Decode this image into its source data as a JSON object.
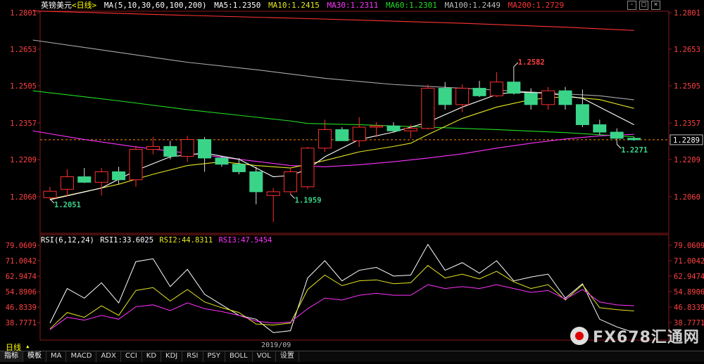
{
  "header": {
    "symbol": "英镑美元",
    "period_tag": "<日线>",
    "ma_params": "MA(5,10,30,60,100,200)",
    "ma5": "MA5:1.2350",
    "ma10": "MA10:1.2415",
    "ma30": "MA30:1.2311",
    "ma60": "MA60:1.2301",
    "ma100": "MA100:1.2449",
    "ma200": "MA200:1.2729"
  },
  "rsi_header": {
    "params": "RSI(6,12,24)",
    "rsi1": "RSI1:33.6025",
    "rsi2": "RSI2:44.8311",
    "rsi3": "RSI3:47.5454"
  },
  "window_controls": [
    "-",
    "□",
    "×"
  ],
  "period_button": "日线",
  "bottom_tabs": [
    "指标",
    "模板",
    "MA",
    "MACD",
    "ADX",
    "CCI",
    "KD",
    "KDJ",
    "RSI",
    "PSY",
    "BOLL",
    "VOL",
    "设置"
  ],
  "watermark": "FX678汇通网",
  "colors": {
    "up": "#ff3030",
    "down": "#3ad489",
    "ma5": "#ffffff",
    "ma10": "#e6e622",
    "ma30": "#ff33ff",
    "ma60": "#22dd22",
    "ma100": "#aaaaaa",
    "ma200": "#ff3333",
    "rsi1": "#ffffff",
    "rsi2": "#e6e622",
    "rsi3": "#ff33ff",
    "axis_text": "#ff4040",
    "dashed": "#ff8800"
  },
  "chart_data": [
    {
      "type": "candlestick",
      "ylim": [
        1.1933,
        1.282
      ],
      "y_ticks": [
        "1.2801",
        "1.2653",
        "1.2505",
        "1.2357",
        "1.2209",
        "1.2060"
      ],
      "x_label": "2019/09",
      "current_price": "1.2289",
      "annotations": [
        {
          "text": "1.2051",
          "candle": 0
        },
        {
          "text": "1.1959",
          "candle": 14
        },
        {
          "text": "1.2582",
          "candle": 27
        },
        {
          "text": "1.2271",
          "candle": 33
        }
      ],
      "candles": [
        {
          "o": 1.2056,
          "h": 1.21,
          "l": 1.2051,
          "c": 1.2082
        },
        {
          "o": 1.209,
          "h": 1.217,
          "l": 1.206,
          "c": 1.214
        },
        {
          "o": 1.214,
          "h": 1.2175,
          "l": 1.2115,
          "c": 1.2118
        },
        {
          "o": 1.2118,
          "h": 1.2175,
          "l": 1.2065,
          "c": 1.216
        },
        {
          "o": 1.216,
          "h": 1.218,
          "l": 1.211,
          "c": 1.2128
        },
        {
          "o": 1.2128,
          "h": 1.2265,
          "l": 1.21,
          "c": 1.225
        },
        {
          "o": 1.225,
          "h": 1.23,
          "l": 1.223,
          "c": 1.2262
        },
        {
          "o": 1.2262,
          "h": 1.2285,
          "l": 1.221,
          "c": 1.2222
        },
        {
          "o": 1.2222,
          "h": 1.2305,
          "l": 1.22,
          "c": 1.229
        },
        {
          "o": 1.229,
          "h": 1.23,
          "l": 1.216,
          "c": 1.2215
        },
        {
          "o": 1.2215,
          "h": 1.2222,
          "l": 1.218,
          "c": 1.219
        },
        {
          "o": 1.219,
          "h": 1.2215,
          "l": 1.215,
          "c": 1.216
        },
        {
          "o": 1.216,
          "h": 1.218,
          "l": 1.203,
          "c": 1.208
        },
        {
          "o": 1.2065,
          "h": 1.2095,
          "l": 1.1959,
          "c": 1.208
        },
        {
          "o": 1.208,
          "h": 1.2175,
          "l": 1.207,
          "c": 1.216
        },
        {
          "o": 1.21,
          "h": 1.226,
          "l": 1.209,
          "c": 1.2255
        },
        {
          "o": 1.2255,
          "h": 1.237,
          "l": 1.224,
          "c": 1.233
        },
        {
          "o": 1.233,
          "h": 1.234,
          "l": 1.2285,
          "c": 1.2285
        },
        {
          "o": 1.2285,
          "h": 1.238,
          "l": 1.226,
          "c": 1.234
        },
        {
          "o": 1.234,
          "h": 1.236,
          "l": 1.23,
          "c": 1.2345
        },
        {
          "o": 1.2345,
          "h": 1.236,
          "l": 1.232,
          "c": 1.2325
        },
        {
          "o": 1.2325,
          "h": 1.235,
          "l": 1.2295,
          "c": 1.2335
        },
        {
          "o": 1.2335,
          "h": 1.251,
          "l": 1.233,
          "c": 1.2495
        },
        {
          "o": 1.2495,
          "h": 1.252,
          "l": 1.241,
          "c": 1.243
        },
        {
          "o": 1.243,
          "h": 1.251,
          "l": 1.24,
          "c": 1.2495
        },
        {
          "o": 1.2495,
          "h": 1.2525,
          "l": 1.246,
          "c": 1.2465
        },
        {
          "o": 1.2465,
          "h": 1.256,
          "l": 1.246,
          "c": 1.252
        },
        {
          "o": 1.252,
          "h": 1.2582,
          "l": 1.247,
          "c": 1.2475
        },
        {
          "o": 1.2475,
          "h": 1.2495,
          "l": 1.241,
          "c": 1.243
        },
        {
          "o": 1.243,
          "h": 1.25,
          "l": 1.241,
          "c": 1.2485
        },
        {
          "o": 1.2485,
          "h": 1.25,
          "l": 1.241,
          "c": 1.243
        },
        {
          "o": 1.243,
          "h": 1.249,
          "l": 1.234,
          "c": 1.235
        },
        {
          "o": 1.235,
          "h": 1.237,
          "l": 1.231,
          "c": 1.232
        },
        {
          "o": 1.232,
          "h": 1.2335,
          "l": 1.2271,
          "c": 1.2295
        },
        {
          "o": 1.2295,
          "h": 1.23,
          "l": 1.2285,
          "c": 1.2289
        }
      ],
      "ma_lines": {
        "ma5": [
          [
            0,
            1.2048
          ],
          [
            3,
            1.2095
          ],
          [
            5,
            1.2165
          ],
          [
            7,
            1.222
          ],
          [
            9,
            1.2235
          ],
          [
            11,
            1.221
          ],
          [
            13,
            1.214
          ],
          [
            14,
            1.2145
          ],
          [
            15,
            1.217
          ],
          [
            16,
            1.222
          ],
          [
            18,
            1.229
          ],
          [
            20,
            1.232
          ],
          [
            22,
            1.236
          ],
          [
            24,
            1.242
          ],
          [
            26,
            1.247
          ],
          [
            27,
            1.248
          ],
          [
            29,
            1.2475
          ],
          [
            31,
            1.2455
          ],
          [
            33,
            1.2385
          ],
          [
            34,
            1.235
          ]
        ],
        "ma10": [
          [
            0,
            1.205
          ],
          [
            4,
            1.211
          ],
          [
            6,
            1.215
          ],
          [
            8,
            1.2185
          ],
          [
            10,
            1.22
          ],
          [
            12,
            1.2185
          ],
          [
            14,
            1.2175
          ],
          [
            16,
            1.2205
          ],
          [
            18,
            1.224
          ],
          [
            20,
            1.2262
          ],
          [
            21,
            1.2275
          ],
          [
            22,
            1.231
          ],
          [
            24,
            1.2375
          ],
          [
            26,
            1.242
          ],
          [
            28,
            1.245
          ],
          [
            30,
            1.2462
          ],
          [
            32,
            1.245
          ],
          [
            34,
            1.2415
          ]
        ],
        "ma30": [
          [
            -1,
            1.2325
          ],
          [
            2,
            1.229
          ],
          [
            5,
            1.226
          ],
          [
            8,
            1.2235
          ],
          [
            11,
            1.221
          ],
          [
            14,
            1.2185
          ],
          [
            16,
            1.218
          ],
          [
            18,
            1.2188
          ],
          [
            20,
            1.22
          ],
          [
            22,
            1.2215
          ],
          [
            24,
            1.2232
          ],
          [
            26,
            1.2255
          ],
          [
            28,
            1.2275
          ],
          [
            30,
            1.2292
          ],
          [
            32,
            1.2305
          ],
          [
            34,
            1.2311
          ]
        ],
        "ma60": [
          [
            -1,
            1.2485
          ],
          [
            4,
            1.2445
          ],
          [
            8,
            1.241
          ],
          [
            12,
            1.238
          ],
          [
            14,
            1.2365
          ],
          [
            15,
            1.2355
          ],
          [
            18,
            1.235
          ],
          [
            22,
            1.234
          ],
          [
            26,
            1.233
          ],
          [
            30,
            1.2318
          ],
          [
            34,
            1.2301
          ]
        ],
        "ma100": [
          [
            -1,
            1.269
          ],
          [
            4,
            1.264
          ],
          [
            8,
            1.26
          ],
          [
            12,
            1.257
          ],
          [
            16,
            1.2535
          ],
          [
            20,
            1.251
          ],
          [
            24,
            1.2495
          ],
          [
            28,
            1.248
          ],
          [
            32,
            1.2465
          ],
          [
            34,
            1.2449
          ]
        ],
        "ma200": [
          [
            -1,
            1.2808
          ],
          [
            8,
            1.279
          ],
          [
            16,
            1.2775
          ],
          [
            24,
            1.2758
          ],
          [
            30,
            1.2742
          ],
          [
            34,
            1.2729
          ]
        ]
      }
    },
    {
      "type": "line",
      "name": "RSI",
      "ylim": [
        31.5,
        81.5
      ],
      "y_ticks": [
        "79.0609",
        "71.0042",
        "62.9474",
        "54.8906",
        "46.8339",
        "38.7771"
      ],
      "series": [
        {
          "name": "RSI1",
          "values": [
            38.5,
            56.5,
            51.5,
            59.5,
            49.0,
            70.5,
            72.0,
            57.5,
            66.5,
            53.5,
            48.0,
            42.5,
            40.5,
            33.5,
            34.5,
            62.0,
            71.0,
            60.5,
            66.0,
            67.5,
            63.0,
            63.5,
            79.5,
            66.0,
            70.0,
            64.5,
            71.0,
            60.5,
            62.5,
            64.0,
            51.5,
            59.0,
            40.5,
            36.5,
            33.6
          ]
        },
        {
          "name": "RSI2",
          "values": [
            35.5,
            44.0,
            41.5,
            47.5,
            42.5,
            55.5,
            57.0,
            50.0,
            56.0,
            49.5,
            46.5,
            44.0,
            38.0,
            37.5,
            38.5,
            56.0,
            63.5,
            58.0,
            60.5,
            61.0,
            59.0,
            59.5,
            68.5,
            62.0,
            64.0,
            61.5,
            65.5,
            60.0,
            56.5,
            58.5,
            50.5,
            58.5,
            46.5,
            45.5,
            44.8
          ]
        },
        {
          "name": "RSI3",
          "values": [
            35.0,
            41.5,
            40.0,
            42.5,
            40.5,
            47.0,
            48.0,
            45.0,
            49.0,
            46.0,
            44.5,
            42.5,
            39.5,
            38.5,
            39.0,
            46.0,
            51.5,
            50.5,
            53.0,
            54.0,
            53.0,
            53.0,
            58.5,
            56.5,
            57.5,
            56.5,
            58.5,
            56.5,
            54.5,
            55.5,
            51.0,
            56.0,
            49.5,
            48.0,
            47.5
          ]
        }
      ]
    }
  ]
}
